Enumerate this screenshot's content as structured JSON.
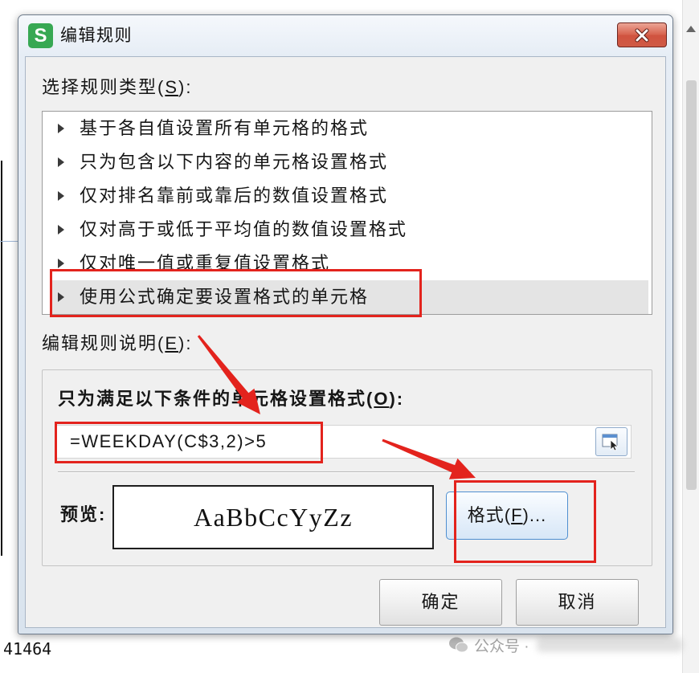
{
  "window": {
    "title": "编辑规则",
    "app_icon": {
      "name": "wps-spreadsheet-icon",
      "letter": "S"
    },
    "close_icon": "close-icon"
  },
  "rule_type": {
    "label": {
      "pre": "选择规则类型(",
      "key": "S",
      "post": "):"
    },
    "items": [
      "基于各自值设置所有单元格的格式",
      "只为包含以下内容的单元格设置格式",
      "仅对排名靠前或靠后的数值设置格式",
      "仅对高于或低于平均值的数值设置格式",
      "仅对唯一值或重复值设置格式",
      "使用公式确定要设置格式的单元格"
    ],
    "selected_index": 5,
    "item_icon": "expand-triangle-icon"
  },
  "rule_description": {
    "label": {
      "pre": "编辑规则说明(",
      "key": "E",
      "post": "):"
    },
    "condition_label": {
      "pre": "只为满足以下条件的单元格设置格式(",
      "key": "O",
      "post": "):"
    },
    "formula": "=WEEKDAY(C$3,2)>5",
    "range_picker_icon": "range-select-icon",
    "preview_label": "预览:",
    "preview_sample": "AaBbCcYyZz",
    "format_button": {
      "pre": "格式(",
      "key": "F",
      "post": ")..."
    }
  },
  "footer": {
    "ok_label": "确定",
    "cancel_label": "取消"
  },
  "background": {
    "cell_value": "41464",
    "scroll_up_icon": "scroll-up-icon"
  },
  "watermark": {
    "icon": "wechat-icon",
    "text": "公众号 ·"
  },
  "colors": {
    "annotation": "#e3231d",
    "app_icon_green": "#37a853",
    "selected_row": "#e4e4e4",
    "close_button": "#d0533f"
  }
}
